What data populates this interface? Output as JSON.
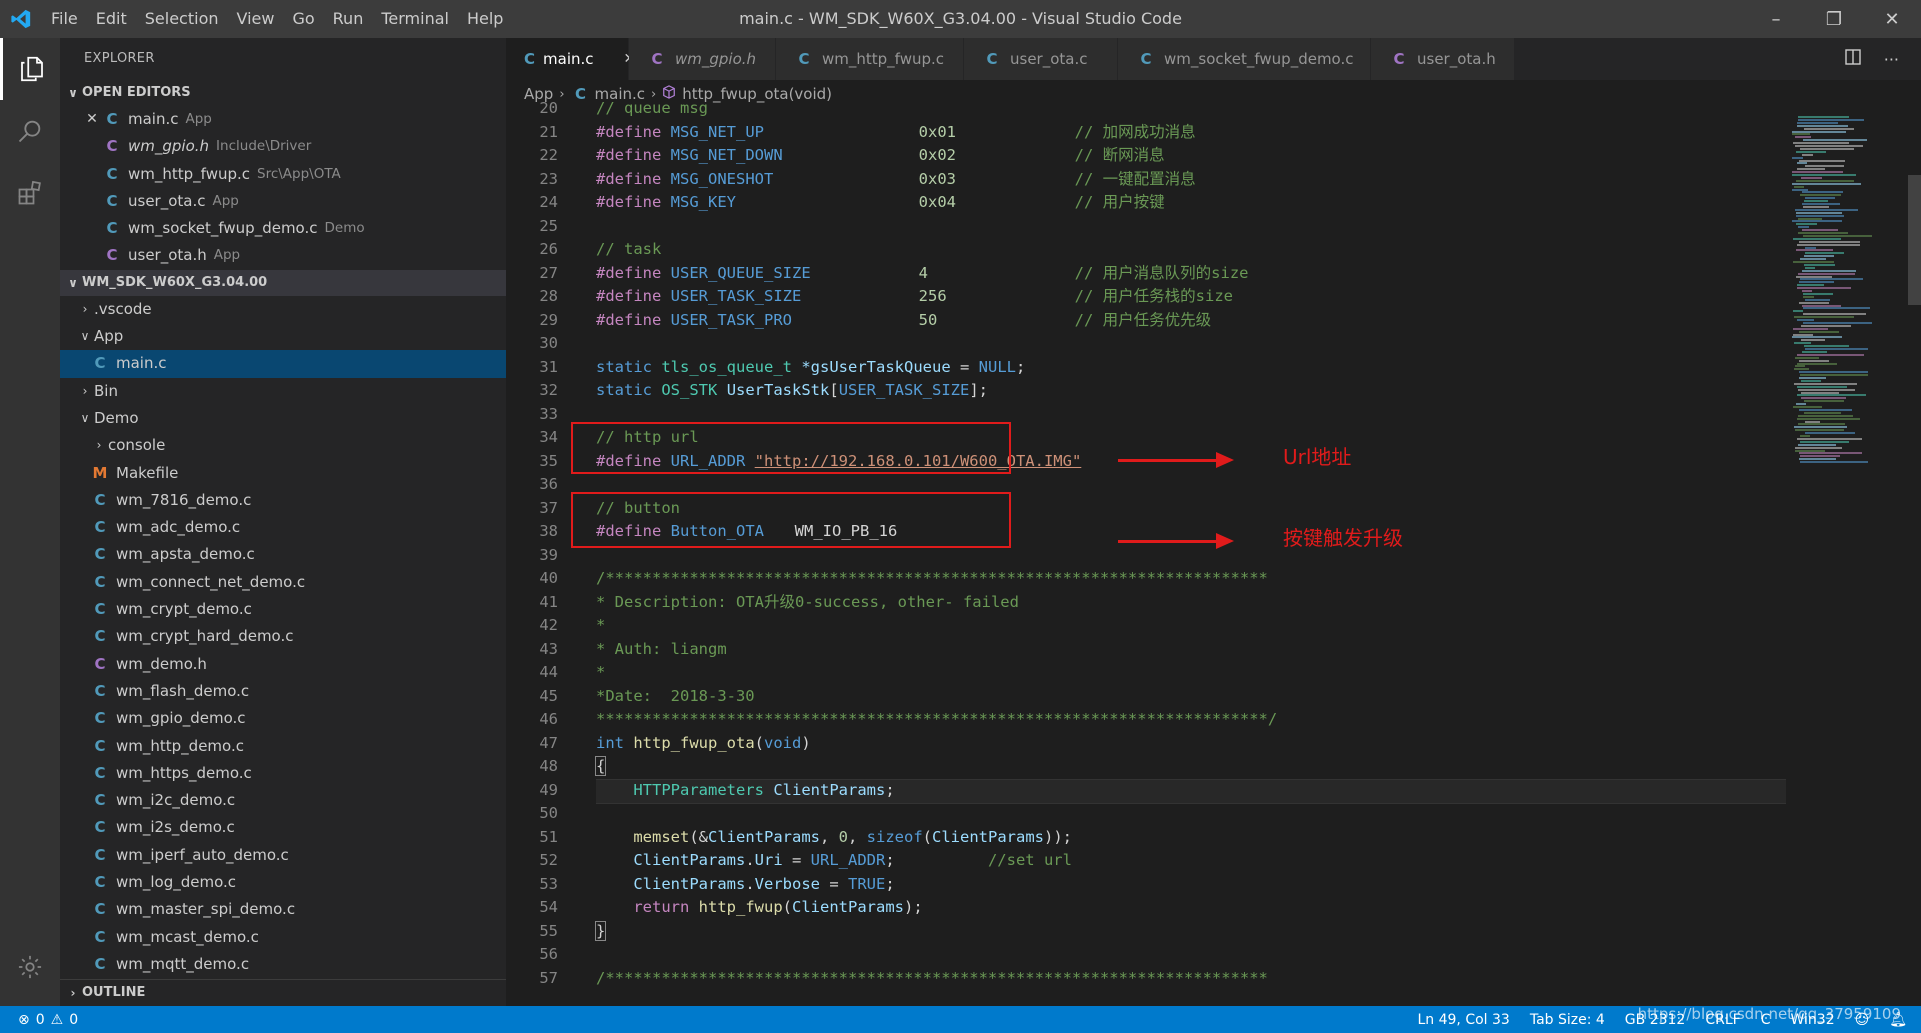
{
  "window": {
    "title": "main.c - WM_SDK_W60X_G3.04.00 - Visual Studio Code",
    "menu": [
      "File",
      "Edit",
      "Selection",
      "View",
      "Go",
      "Run",
      "Terminal",
      "Help"
    ],
    "controls": {
      "minimize": "–",
      "restore": "❐",
      "close": "✕"
    }
  },
  "activitybar": {
    "icons": [
      "explorer-icon",
      "search-icon",
      "extensions-icon",
      "gear-icon"
    ]
  },
  "sidebar": {
    "title": "EXPLORER",
    "open_editors_header": "OPEN EDITORS",
    "open_editors": [
      {
        "icon": "C",
        "name": "main.c",
        "desc": "App"
      },
      {
        "icon": "C",
        "name": "wm_gpio.h",
        "desc": "Include\\Driver"
      },
      {
        "icon": "C",
        "name": "wm_http_fwup.c",
        "desc": "Src\\App\\OTA"
      },
      {
        "icon": "C",
        "name": "user_ota.c",
        "desc": "App"
      },
      {
        "icon": "C",
        "name": "wm_socket_fwup_demo.c",
        "desc": "Demo"
      },
      {
        "icon": "C",
        "name": "user_ota.h",
        "desc": "App"
      }
    ],
    "root_header": "WM_SDK_W60X_G3.04.00",
    "tree": [
      {
        "name": ".vscode",
        "type": "folder-collapsed"
      },
      {
        "name": "App",
        "type": "folder-expanded"
      },
      {
        "name": "main.c",
        "type": "c"
      },
      {
        "name": "Bin",
        "type": "folder-collapsed"
      },
      {
        "name": "Demo",
        "type": "folder-expanded"
      },
      {
        "name": "console",
        "type": "folder-collapsed"
      },
      {
        "name": "Makefile",
        "type": "make"
      },
      {
        "name": "wm_7816_demo.c",
        "type": "c"
      },
      {
        "name": "wm_adc_demo.c",
        "type": "c"
      },
      {
        "name": "wm_apsta_demo.c",
        "type": "c"
      },
      {
        "name": "wm_connect_net_demo.c",
        "type": "c"
      },
      {
        "name": "wm_crypt_demo.c",
        "type": "c"
      },
      {
        "name": "wm_crypt_hard_demo.c",
        "type": "c"
      },
      {
        "name": "wm_demo.h",
        "type": "h"
      },
      {
        "name": "wm_flash_demo.c",
        "type": "c"
      },
      {
        "name": "wm_gpio_demo.c",
        "type": "c"
      },
      {
        "name": "wm_http_demo.c",
        "type": "c"
      },
      {
        "name": "wm_https_demo.c",
        "type": "c"
      },
      {
        "name": "wm_i2c_demo.c",
        "type": "c"
      },
      {
        "name": "wm_i2s_demo.c",
        "type": "c"
      },
      {
        "name": "wm_iperf_auto_demo.c",
        "type": "c"
      },
      {
        "name": "wm_log_demo.c",
        "type": "c"
      },
      {
        "name": "wm_master_spi_demo.c",
        "type": "c"
      },
      {
        "name": "wm_mcast_demo.c",
        "type": "c"
      },
      {
        "name": "wm_mqtt_demo.c",
        "type": "c"
      }
    ],
    "outline_header": "OUTLINE"
  },
  "tabs": [
    {
      "icon": "C",
      "label": "main.c",
      "close": "✕"
    },
    {
      "icon": "C",
      "label": "wm_gpio.h"
    },
    {
      "icon": "C",
      "label": "wm_http_fwup.c"
    },
    {
      "icon": "C",
      "label": "user_ota.c"
    },
    {
      "icon": "C",
      "label": "wm_socket_fwup_demo.c"
    },
    {
      "icon": "C",
      "label": "user_ota.h"
    }
  ],
  "breadcrumbs": {
    "app": "App",
    "file": "main.c",
    "symbol": "http_fwup_ota(void)"
  },
  "code": {
    "l20": "20",
    "l20_text": "// queue msg",
    "l21": "21",
    "l21_name": "MSG_NET_UP",
    "l21_val": "0x01",
    "l21_cm": "// 加网成功消息",
    "l22": "22",
    "l22_name": "MSG_NET_DOWN",
    "l22_val": "0x02",
    "l22_cm": "// 断网消息",
    "l23": "23",
    "l23_name": "MSG_ONESHOT",
    "l23_val": "0x03",
    "l23_cm": "// 一键配置消息",
    "l24": "24",
    "l24_name": "MSG_KEY",
    "l24_val": "0x04",
    "l24_cm": "// 用户按键",
    "l25": "25",
    "l26": "26",
    "l26_text": "// task",
    "l27": "27",
    "l27_name": "USER_QUEUE_SIZE",
    "l27_val": "4",
    "l27_cm": "// 用户消息队列的size",
    "l28": "28",
    "l28_name": "USER_TASK_SIZE",
    "l28_val": "256",
    "l28_cm": "// 用户任务栈的size",
    "l29": "29",
    "l29_name": "USER_TASK_PRO",
    "l29_val": "50",
    "l29_cm": "// 用户任务优先级",
    "l30": "30",
    "l31": "31",
    "l31_kw": "static",
    "l31_ty": "tls_os_queue_t",
    "l31_var": "*gsUserTaskQueue",
    "l31_rest": " = ",
    "l31_null": "NULL",
    "l32": "32",
    "l32_kw": "static",
    "l32_ty": "OS_STK",
    "l32_var": "UserTaskStk",
    "l32_mac": "USER_TASK_SIZE",
    "l33": "33",
    "l34": "34",
    "l34_text": "// http url",
    "l35": "35",
    "l35_name": "URL_ADDR",
    "l35_str": "\"http://192.168.0.101/W600_OTA.IMG\"",
    "l36": "36",
    "l37": "37",
    "l37_text": "// button",
    "l38": "38",
    "l38_name": "Button_OTA",
    "l38_val": "WM_IO_PB_16",
    "l39": "39",
    "l40": "40",
    "l40_text": "/***********************************************************************",
    "l41": "41",
    "l41_text": "* Description: OTA升级0-success, other- failed",
    "l42": "42",
    "l42_text": "*",
    "l43": "43",
    "l43_text": "* Auth: liangm",
    "l44": "44",
    "l44_text": "*",
    "l45": "45",
    "l45_text": "*Date:  2018-3-30",
    "l46": "46",
    "l46_text": "************************************************************************/",
    "l47": "47",
    "l47_kw": "int",
    "l47_fn": "http_fwup_ota",
    "l47_arg": "void",
    "l48": "48",
    "l48_text": "{",
    "l49": "49",
    "l49_ty": "HTTPParameters",
    "l49_var": "ClientParams",
    "l50": "50",
    "l51": "51",
    "l51_fn": "memset",
    "l51_var": "ClientParams",
    "l51_num": "0",
    "l51_kw": "sizeof",
    "l51_var2": "ClientParams",
    "l52": "52",
    "l52_var": "ClientParams",
    "l52_field": "Uri",
    "l52_mac": "URL_ADDR",
    "l52_cm": "//set url",
    "l53": "53",
    "l53_var": "ClientParams",
    "l53_field": "Verbose",
    "l53_mac": "TRUE",
    "l54": "54",
    "l54_kw": "return",
    "l54_fn": "http_fwup",
    "l54_var": "ClientParams",
    "l55": "55",
    "l55_text": "}",
    "l56": "56",
    "l57": "57",
    "l57_text": "/***********************************************************************",
    "define_kw": "#define"
  },
  "annotations": {
    "url_label": "Url地址",
    "button_label": "按键触发升级",
    "color": "#e01b1b"
  },
  "statusbar": {
    "errors": "0",
    "warnings": "0",
    "position": "Ln 49, Col 33",
    "tab_size": "Tab Size: 4",
    "encoding": "GB 2312",
    "eol": "CRLF",
    "lang": "C",
    "platform": "Win32",
    "watermark": "https://blog.csdn.net/qq_37959109"
  }
}
